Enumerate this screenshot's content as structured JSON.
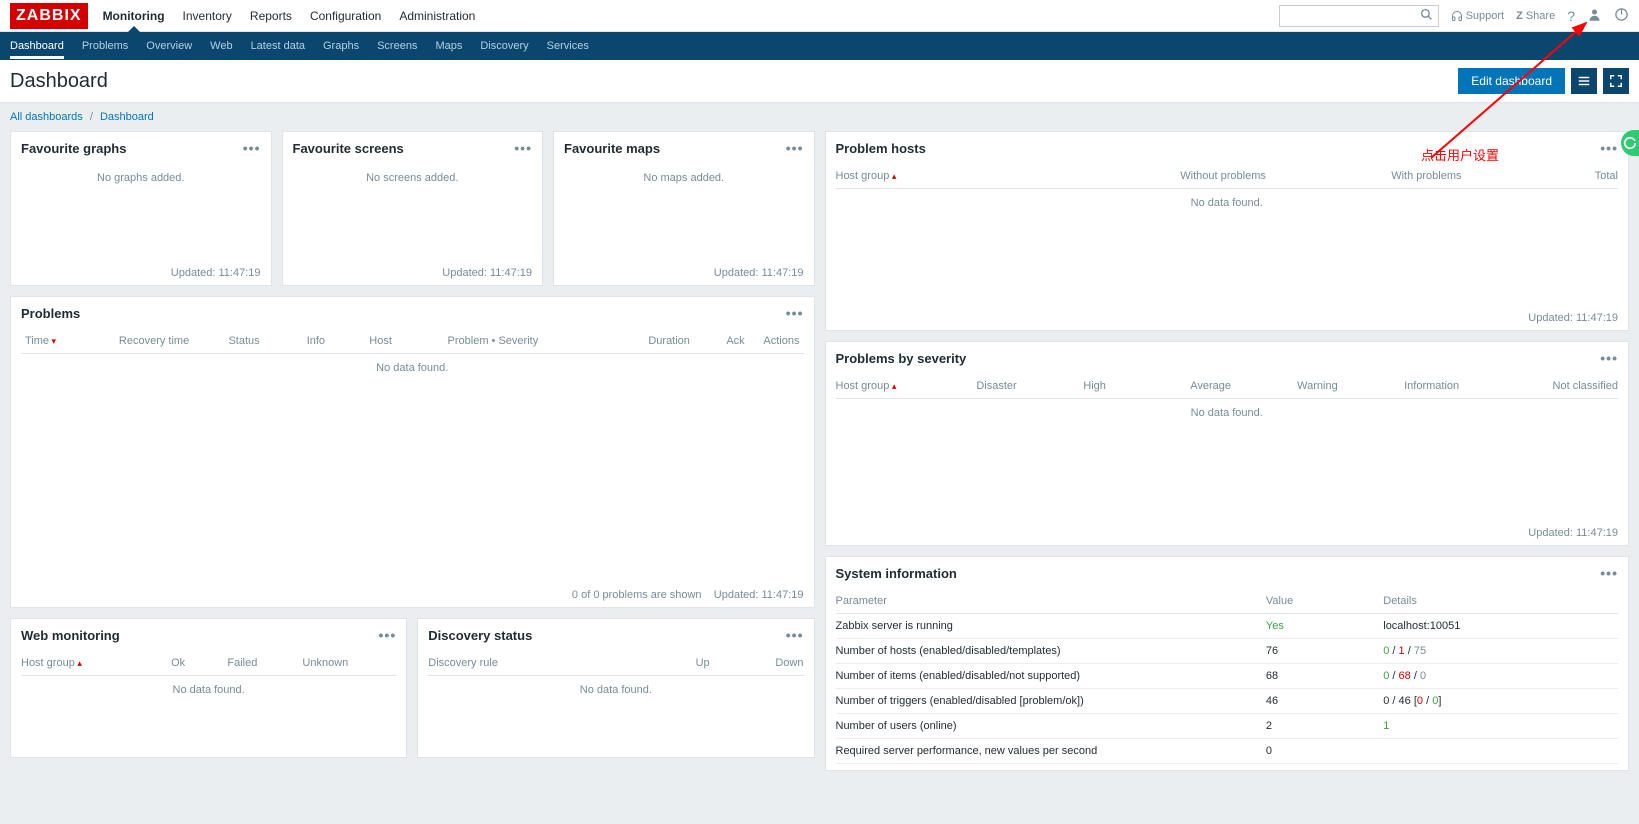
{
  "logo": "ZABBIX",
  "top_nav": [
    "Monitoring",
    "Inventory",
    "Reports",
    "Configuration",
    "Administration"
  ],
  "top_nav_active": 0,
  "top_right": {
    "support": "Support",
    "share": "Share"
  },
  "sub_nav": [
    "Dashboard",
    "Problems",
    "Overview",
    "Web",
    "Latest data",
    "Graphs",
    "Screens",
    "Maps",
    "Discovery",
    "Services"
  ],
  "sub_nav_active": 0,
  "page_title": "Dashboard",
  "edit_button": "Edit dashboard",
  "breadcrumb": {
    "all": "All dashboards",
    "current": "Dashboard"
  },
  "widgets": {
    "fav_graphs": {
      "title": "Favourite graphs",
      "empty": "No graphs added.",
      "updated": "Updated: 11:47:19"
    },
    "fav_screens": {
      "title": "Favourite screens",
      "empty": "No screens added.",
      "updated": "Updated: 11:47:19"
    },
    "fav_maps": {
      "title": "Favourite maps",
      "empty": "No maps added.",
      "updated": "Updated: 11:47:19"
    },
    "problems": {
      "title": "Problems",
      "cols": [
        "Time",
        "Recovery time",
        "Status",
        "Info",
        "Host",
        "Problem • Severity",
        "Duration",
        "Ack",
        "Actions"
      ],
      "no_data": "No data found.",
      "footer_count": "0 of 0 problems are shown",
      "updated": "Updated: 11:47:19"
    },
    "web_mon": {
      "title": "Web monitoring",
      "cols": [
        "Host group",
        "Ok",
        "Failed",
        "Unknown"
      ],
      "no_data": "No data found."
    },
    "discovery": {
      "title": "Discovery status",
      "cols": [
        "Discovery rule",
        "Up",
        "Down"
      ],
      "no_data": "No data found."
    },
    "problem_hosts": {
      "title": "Problem hosts",
      "cols": [
        "Host group",
        "Without problems",
        "With problems",
        "Total"
      ],
      "no_data": "No data found.",
      "updated": "Updated: 11:47:19"
    },
    "severity": {
      "title": "Problems by severity",
      "cols": [
        "Host group",
        "Disaster",
        "High",
        "Average",
        "Warning",
        "Information",
        "Not classified"
      ],
      "no_data": "No data found.",
      "updated": "Updated: 11:47:19"
    },
    "sysinfo": {
      "title": "System information",
      "cols": [
        "Parameter",
        "Value",
        "Details"
      ],
      "rows": [
        {
          "param": "Zabbix server is running",
          "value": "Yes",
          "value_class": "green",
          "details_html": "localhost:10051"
        },
        {
          "param": "Number of hosts (enabled/disabled/templates)",
          "value": "76",
          "details_html": "<span class='green'>0</span> / <span class='red'>1</span> / <span class='grey'>75</span>"
        },
        {
          "param": "Number of items (enabled/disabled/not supported)",
          "value": "68",
          "details_html": "<span class='green'>0</span> / <span class='red'>68</span> / <span class='grey'>0</span>"
        },
        {
          "param": "Number of triggers (enabled/disabled [problem/ok])",
          "value": "46",
          "details_html": "0 / 46 [<span class='red'>0</span> / <span class='green'>0</span>]"
        },
        {
          "param": "Number of users (online)",
          "value": "2",
          "details_html": "<span class='green'>1</span>"
        },
        {
          "param": "Required server performance, new values per second",
          "value": "0",
          "details_html": ""
        }
      ]
    }
  },
  "annotation": "点击用户设置"
}
